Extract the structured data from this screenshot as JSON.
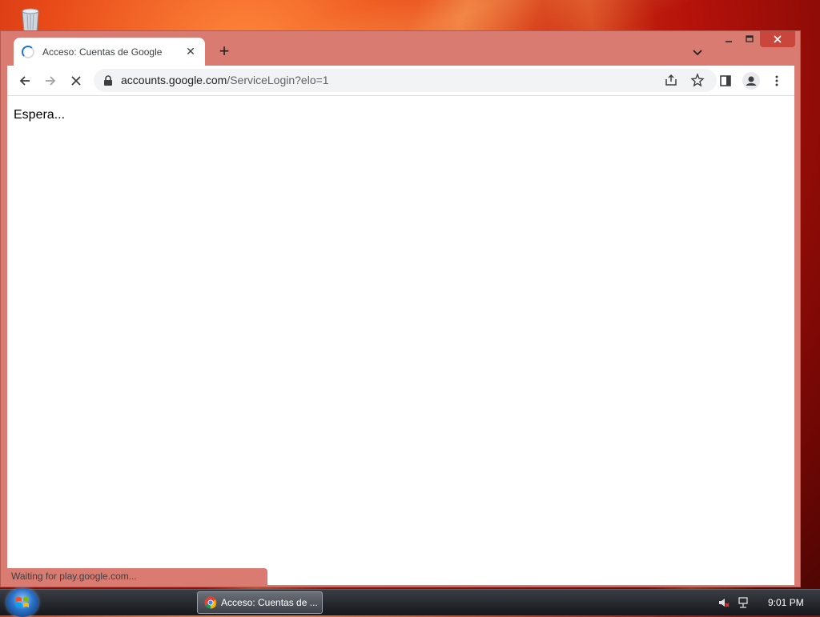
{
  "desktop": {
    "icon": "recycle-bin-icon"
  },
  "browser": {
    "tab": {
      "title": "Acceso: Cuentas de Google",
      "close_symbol": "✕"
    },
    "new_tab_symbol": "+",
    "address": {
      "host": "accounts.google.com",
      "path": "/ServiceLogin?elo=1"
    },
    "page_text": "Espera...",
    "status_text": "Waiting for play.google.com..."
  },
  "taskbar": {
    "item_label": "Acceso: Cuentas de ...",
    "clock": "9:01 PM"
  },
  "colors": {
    "frame": "#d97b70",
    "close_button": "#c9463d",
    "spinner": "#1a73e8"
  }
}
